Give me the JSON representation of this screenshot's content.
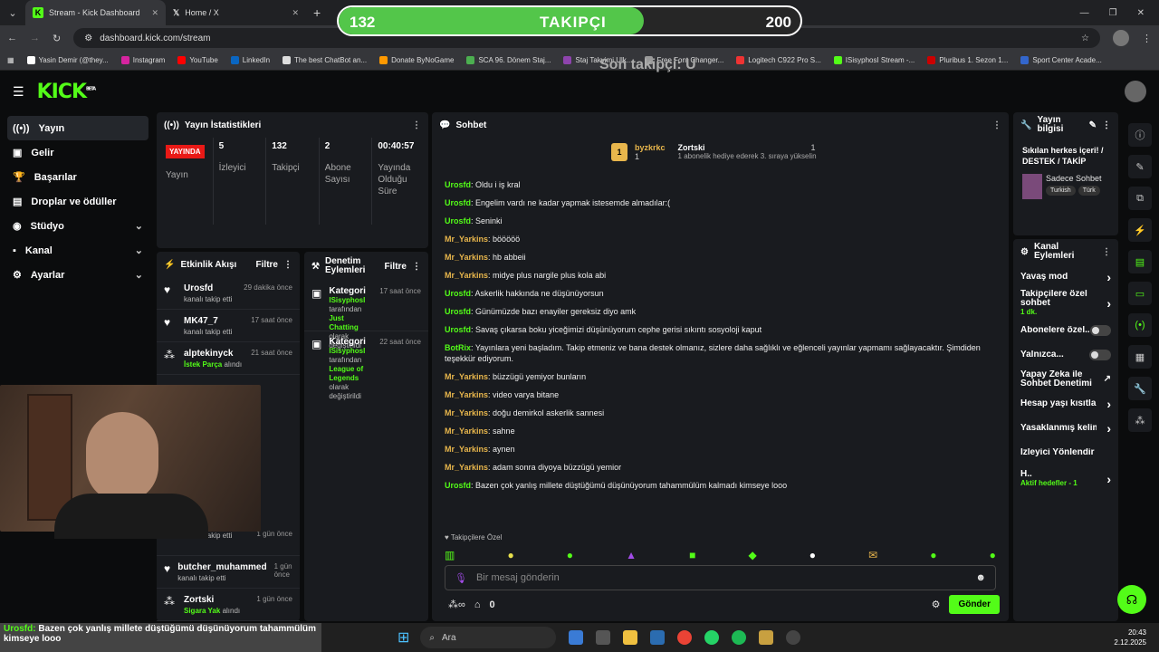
{
  "browser": {
    "tabs": [
      {
        "label": "Stream - Kick Dashboard"
      },
      {
        "label": "Home / X"
      }
    ],
    "url": "dashboard.kick.com/stream",
    "bookmarks": [
      "Yasin Demir (@they...",
      "Instagram",
      "YouTube",
      "LinkedIn",
      "The best ChatBot an...",
      "Donate ByNoGame",
      "SCA 96. Dönem Staj...",
      "Staj Takvimi Ulk...",
      "Free Font Changer...",
      "Logitech C922 Pro S...",
      "ISisyphosI Stream -...",
      "Pluribus 1. Sezon 1...",
      "Sport Center Acade..."
    ]
  },
  "overlay": {
    "follow_current": "132",
    "follow_label": "TAKIPÇI",
    "follow_goal": "200",
    "follow_progress": 0.66,
    "last_follower": "Son takipçi: U"
  },
  "nav": {
    "logo": "KICK",
    "logo_badge": "BETA",
    "items": [
      {
        "label": "Yayın"
      },
      {
        "label": "Gelir"
      },
      {
        "label": "Başarılar"
      },
      {
        "label": "Droplar ve ödüller"
      },
      {
        "label": "Stüdyo"
      },
      {
        "label": "Kanal"
      },
      {
        "label": "Ayarlar"
      }
    ]
  },
  "stats": {
    "title": "Yayın İstatistikleri",
    "live": "YAYINDA",
    "items": [
      {
        "value": "",
        "label": "Yayın"
      },
      {
        "value": "5",
        "label": "İzleyici"
      },
      {
        "value": "132",
        "label": "Takipçi"
      },
      {
        "value": "2",
        "label": "Abone Sayısı"
      },
      {
        "value": "00:40:57",
        "label": "Yayında Olduğu Süre"
      }
    ]
  },
  "activity": {
    "title": "Etkinlik Akışı",
    "filter": "Filtre",
    "rows": [
      {
        "name": "Urosfd",
        "sub": "kanalı takip etti",
        "time": "29 dakika önce"
      },
      {
        "name": "MK47_7",
        "sub": "kanalı takip etti",
        "time": "17 saat önce"
      },
      {
        "name": "alptekinyck",
        "sub_b": "İstek Parça",
        "sub": "alındı",
        "time": "21 saat önce"
      }
    ],
    "bottom_rows": [
      {
        "name": "",
        "sub": "kanalı takip etti",
        "time": "1 gün önce"
      },
      {
        "name": "butcher_muhammed",
        "sub": "kanalı takip etti",
        "time": "1 gün önce"
      },
      {
        "name": "Zortski",
        "sub_b": "Sigara Yak",
        "sub": "alındı",
        "time": "1 gün önce"
      }
    ]
  },
  "moderation": {
    "title": "Denetim Eylemleri",
    "filter": "Filtre",
    "rows": [
      {
        "name": "Kategori",
        "time": "17 saat önce",
        "by": "ISisyphosI",
        "by_suffix": "tarafından",
        "value": "Just Chatting",
        "value_suffix": "olarak",
        "tail": "değiştirildi"
      },
      {
        "name": "Kategori",
        "time": "22 saat önce",
        "by": "ISisyphosI",
        "by_suffix": "tarafından",
        "value": "League of Legends",
        "value_suffix": "",
        "tail": "olarak değiştirildi"
      }
    ]
  },
  "chat": {
    "title": "Sohbet",
    "gifter1": "byzkrkc",
    "gifter1_count": "1",
    "gifter2": "Zortski",
    "gifter2_count": "1",
    "gift_note": "1 abonelik hediye ederek 3. sıraya yükselin",
    "messages": [
      {
        "user": "Urosfd",
        "text": "Oldu i iş kral",
        "color": "#53fc18"
      },
      {
        "user": "Urosfd",
        "text": "Engelim vardı ne kadar yapmak istesemde almadılar:(",
        "color": "#53fc18"
      },
      {
        "user": "Urosfd",
        "text": "Seninki",
        "color": "#53fc18"
      },
      {
        "user": "Mr_Yarkins",
        "text": "bööööö",
        "color": "#e8b64c"
      },
      {
        "user": "Mr_Yarkins",
        "text": "hb abbeii",
        "color": "#e8b64c"
      },
      {
        "user": "Mr_Yarkins",
        "text": "midye plus nargile plus kola abi",
        "color": "#e8b64c"
      },
      {
        "user": "Urosfd",
        "text": "Askerlik hakkında ne düşünüyorsun",
        "color": "#53fc18"
      },
      {
        "user": "Urosfd",
        "text": "Günümüzde bazı enayiler gereksiz diyo amk",
        "color": "#53fc18"
      },
      {
        "user": "Urosfd",
        "text": "Savaş çıkarsa boku yiceğimizi düşünüyorum cephe gerisi sıkıntı sosyoloji kaput",
        "color": "#53fc18"
      },
      {
        "user": "BotRix",
        "text": "Yayınlara yeni başladım. Takip etmeniz ve bana destek olmanız, sizlere daha sağlıklı ve eğlenceli yayınlar yapmamı sağlayacaktır. Şimdiden teşekkür ediyorum.",
        "color": "#53fc18"
      },
      {
        "user": "Mr_Yarkins",
        "text": "büzzügü yemiyor bunların",
        "color": "#e8b64c"
      },
      {
        "user": "Mr_Yarkins",
        "text": "video varya bitane",
        "color": "#e8b64c"
      },
      {
        "user": "Mr_Yarkins",
        "text": "doğu demirkol askerlik sannesi",
        "color": "#e8b64c"
      },
      {
        "user": "Mr_Yarkins",
        "text": "sahne",
        "color": "#e8b64c"
      },
      {
        "user": "Mr_Yarkins",
        "text": "aynen",
        "color": "#e8b64c"
      },
      {
        "user": "Mr_Yarkins",
        "text": "adam sonra diyoya büzzügü yemior",
        "color": "#e8b64c"
      },
      {
        "user": "Urosfd",
        "text": "Bazen çok yanlış millete düştüğümü düşünüyorum tahammülüm kalmadı kimseye looo",
        "color": "#53fc18"
      }
    ],
    "followers_only": "Takipçilere Özel",
    "placeholder": "Bir mesaj gönderin",
    "points": "0",
    "send": "Gönder"
  },
  "stream_info": {
    "title": "Yayın bilgisi",
    "stream_title": "Sıkılan herkes içeri! / DESTEK / TAKİP",
    "category": "Sadece Sohbet",
    "tags": [
      "Turkish",
      "Türk"
    ]
  },
  "channel_actions": {
    "title": "Kanal Eylemleri",
    "rows": [
      {
        "label": "Yavaş mod",
        "type": "chev"
      },
      {
        "label": "Takipçilere özel sohbet",
        "sub": "1 dk.",
        "type": "chev"
      },
      {
        "label": "Abonelere özel...",
        "type": "toggle"
      },
      {
        "label": "Yalnızca...",
        "type": "toggle"
      },
      {
        "label": "Yapay Zeka ile Sohbet Denetimi",
        "type": "ext"
      },
      {
        "label": "Hesap yaşı kısıtlam",
        "type": "chev"
      },
      {
        "label": "Yasaklanmış kelime",
        "type": "chev"
      },
      {
        "label": "İzleyici Yönlendir",
        "type": "none"
      },
      {
        "label": "H..",
        "sub": "Aktif hedefler - 1",
        "type": "chev"
      }
    ]
  },
  "subtitle": {
    "name": "Urosfd:",
    "text": "Bazen çok yanlış millete düştüğümü düşünüyorum tahammülüm kimseye looo"
  },
  "taskbar": {
    "search": "Ara",
    "time": "20:43",
    "date": "2.12.2025"
  }
}
